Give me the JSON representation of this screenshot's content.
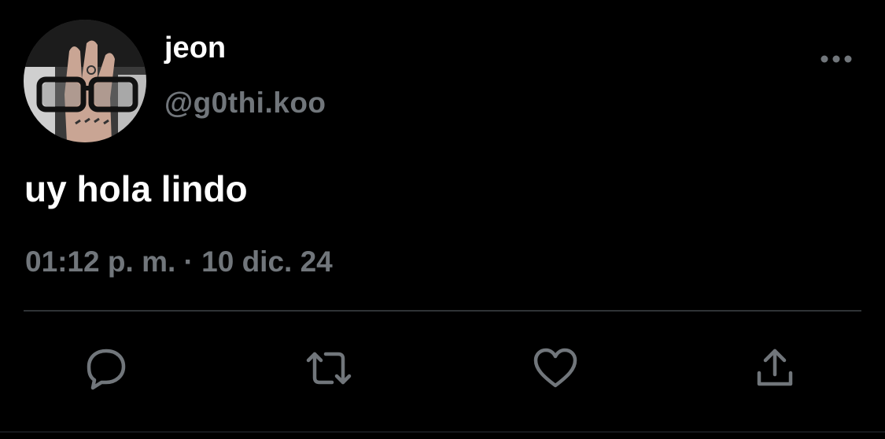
{
  "tweet": {
    "display_name": "jeon",
    "handle": "@g0thi.koo",
    "text": "uy hola lindo",
    "timestamp": "01:12 p. m. · 10 dic. 24"
  },
  "icons": {
    "more": "more-horizontal-icon",
    "reply": "reply-icon",
    "retweet": "retweet-icon",
    "like": "heart-icon",
    "share": "share-icon"
  },
  "colors": {
    "background": "#000000",
    "primary_text": "#ffffff",
    "secondary_text": "#71767b",
    "divider": "#2f3336"
  }
}
